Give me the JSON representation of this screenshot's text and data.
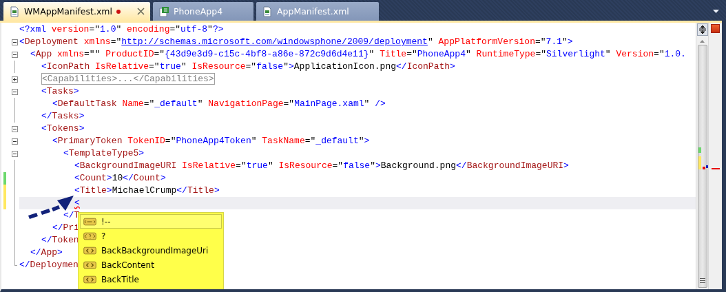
{
  "tabs": [
    {
      "label": "WMAppManifest.xml",
      "kind": "xml",
      "selected": true,
      "modified": true
    },
    {
      "label": "PhoneApp4",
      "kind": "project",
      "selected": false,
      "modified": false
    },
    {
      "label": "AppManifest.xml",
      "kind": "xml",
      "selected": false,
      "modified": false
    }
  ],
  "editor": {
    "lines": [
      {
        "tokens": [
          {
            "kind": "punct",
            "text": "<?xml"
          },
          {
            "kind": "attr",
            "text": " version"
          },
          {
            "kind": "quote",
            "text": "=\""
          },
          {
            "kind": "value",
            "text": "1.0"
          },
          {
            "kind": "quote",
            "text": "\""
          },
          {
            "kind": "attr",
            "text": " encoding"
          },
          {
            "kind": "quote",
            "text": "=\""
          },
          {
            "kind": "value",
            "text": "utf-8"
          },
          {
            "kind": "quote",
            "text": "\""
          },
          {
            "kind": "punct",
            "text": "?>"
          }
        ]
      },
      {
        "expanded": true,
        "tokens": [
          {
            "kind": "punct",
            "text": "<"
          },
          {
            "kind": "tag",
            "text": "Deployment"
          },
          {
            "kind": "attr",
            "text": " xmlns"
          },
          {
            "kind": "quote",
            "text": "=\""
          },
          {
            "kind": "link",
            "text": "http://schemas.microsoft.com/windowsphone/2009/deployment"
          },
          {
            "kind": "quote",
            "text": "\""
          },
          {
            "kind": "attr",
            "text": " AppPlatformVersion"
          },
          {
            "kind": "quote",
            "text": "=\""
          },
          {
            "kind": "value",
            "text": "7.1"
          },
          {
            "kind": "quote",
            "text": "\""
          },
          {
            "kind": "punct",
            "text": ">"
          }
        ],
        "children": [
          {
            "expanded": true,
            "tokens": [
              {
                "kind": "punct",
                "text": "<"
              },
              {
                "kind": "tag",
                "text": "App"
              },
              {
                "kind": "attr",
                "text": " xmlns"
              },
              {
                "kind": "quote",
                "text": "=\"\""
              },
              {
                "kind": "attr",
                "text": " ProductID"
              },
              {
                "kind": "quote",
                "text": "=\""
              },
              {
                "kind": "value",
                "text": "{43d9e3d9-c15c-4bf8-a86e-872c9d6d4e11}"
              },
              {
                "kind": "quote",
                "text": "\""
              },
              {
                "kind": "attr",
                "text": " Title"
              },
              {
                "kind": "quote",
                "text": "=\""
              },
              {
                "kind": "value",
                "text": "PhoneApp4"
              },
              {
                "kind": "quote",
                "text": "\""
              },
              {
                "kind": "attr",
                "text": " RuntimeType"
              },
              {
                "kind": "quote",
                "text": "=\""
              },
              {
                "kind": "value",
                "text": "Silverlight"
              },
              {
                "kind": "quote",
                "text": "\""
              },
              {
                "kind": "attr",
                "text": " Version"
              },
              {
                "kind": "quote",
                "text": "=\""
              },
              {
                "kind": "value",
                "text": "1.0."
              }
            ],
            "children": [
              {
                "tokens": [
                  {
                    "kind": "punct",
                    "text": "<"
                  },
                  {
                    "kind": "tag",
                    "text": "IconPath"
                  },
                  {
                    "kind": "attr",
                    "text": " IsRelative"
                  },
                  {
                    "kind": "quote",
                    "text": "=\""
                  },
                  {
                    "kind": "value",
                    "text": "true"
                  },
                  {
                    "kind": "quote",
                    "text": "\""
                  },
                  {
                    "kind": "attr",
                    "text": " IsResource"
                  },
                  {
                    "kind": "quote",
                    "text": "=\""
                  },
                  {
                    "kind": "value",
                    "text": "false"
                  },
                  {
                    "kind": "quote",
                    "text": "\""
                  },
                  {
                    "kind": "punct",
                    "text": ">"
                  },
                  {
                    "kind": "text",
                    "text": "ApplicationIcon.png"
                  },
                  {
                    "kind": "punct",
                    "text": "</"
                  },
                  {
                    "kind": "tag",
                    "text": "IconPath"
                  },
                  {
                    "kind": "punct",
                    "text": ">"
                  }
                ]
              },
              {
                "expanded": false,
                "tokens": [
                  {
                    "kind": "collapsed",
                    "text": "<Capabilities>...</Capabilities>"
                  }
                ]
              },
              {
                "expanded": true,
                "tokens": [
                  {
                    "kind": "punct",
                    "text": "<"
                  },
                  {
                    "kind": "tag",
                    "text": "Tasks"
                  },
                  {
                    "kind": "punct",
                    "text": ">"
                  }
                ],
                "children": [
                  {
                    "tokens": [
                      {
                        "kind": "punct",
                        "text": "<"
                      },
                      {
                        "kind": "tag",
                        "text": "DefaultTask"
                      },
                      {
                        "kind": "attr",
                        "text": " Name"
                      },
                      {
                        "kind": "quote",
                        "text": "=\""
                      },
                      {
                        "kind": "value",
                        "text": "_default"
                      },
                      {
                        "kind": "quote",
                        "text": "\""
                      },
                      {
                        "kind": "attr",
                        "text": " NavigationPage"
                      },
                      {
                        "kind": "quote",
                        "text": "=\""
                      },
                      {
                        "kind": "value",
                        "text": "MainPage.xaml"
                      },
                      {
                        "kind": "quote",
                        "text": "\""
                      },
                      {
                        "kind": "punct",
                        "text": " />"
                      }
                    ]
                  }
                ]
              },
              {
                "tokens": [
                  {
                    "kind": "punct",
                    "text": "</"
                  },
                  {
                    "kind": "tag",
                    "text": "Tasks"
                  },
                  {
                    "kind": "punct",
                    "text": ">"
                  }
                ]
              },
              {
                "expanded": true,
                "tokens": [
                  {
                    "kind": "punct",
                    "text": "<"
                  },
                  {
                    "kind": "tag",
                    "text": "Tokens"
                  },
                  {
                    "kind": "punct",
                    "text": ">"
                  }
                ],
                "children": [
                  {
                    "expanded": true,
                    "tokens": [
                      {
                        "kind": "punct",
                        "text": "<"
                      },
                      {
                        "kind": "tag",
                        "text": "PrimaryToken"
                      },
                      {
                        "kind": "attr",
                        "text": " TokenID"
                      },
                      {
                        "kind": "quote",
                        "text": "=\""
                      },
                      {
                        "kind": "value",
                        "text": "PhoneApp4Token"
                      },
                      {
                        "kind": "quote",
                        "text": "\""
                      },
                      {
                        "kind": "attr",
                        "text": " TaskName"
                      },
                      {
                        "kind": "quote",
                        "text": "=\""
                      },
                      {
                        "kind": "value",
                        "text": "_default"
                      },
                      {
                        "kind": "quote",
                        "text": "\""
                      },
                      {
                        "kind": "punct",
                        "text": ">"
                      }
                    ],
                    "children": [
                      {
                        "expanded": true,
                        "tokens": [
                          {
                            "kind": "punct",
                            "text": "<"
                          },
                          {
                            "kind": "tag",
                            "text": "TemplateType5"
                          },
                          {
                            "kind": "punct",
                            "text": ">"
                          }
                        ],
                        "children": [
                          {
                            "tokens": [
                              {
                                "kind": "punct",
                                "text": "<"
                              },
                              {
                                "kind": "tag",
                                "text": "BackgroundImageURI"
                              },
                              {
                                "kind": "attr",
                                "text": " IsRelative"
                              },
                              {
                                "kind": "quote",
                                "text": "=\""
                              },
                              {
                                "kind": "value",
                                "text": "true"
                              },
                              {
                                "kind": "quote",
                                "text": "\""
                              },
                              {
                                "kind": "attr",
                                "text": " IsResource"
                              },
                              {
                                "kind": "quote",
                                "text": "=\""
                              },
                              {
                                "kind": "value",
                                "text": "false"
                              },
                              {
                                "kind": "quote",
                                "text": "\""
                              },
                              {
                                "kind": "punct",
                                "text": ">"
                              },
                              {
                                "kind": "text",
                                "text": "Background.png"
                              },
                              {
                                "kind": "punct",
                                "text": "</"
                              },
                              {
                                "kind": "tag",
                                "text": "BackgroundImageURI"
                              },
                              {
                                "kind": "punct",
                                "text": ">"
                              }
                            ]
                          },
                          {
                            "changed": true,
                            "saved": true,
                            "tokens": [
                              {
                                "kind": "punct",
                                "text": "<"
                              },
                              {
                                "kind": "tag",
                                "text": "Count"
                              },
                              {
                                "kind": "punct",
                                "text": ">"
                              },
                              {
                                "kind": "text",
                                "text": "10"
                              },
                              {
                                "kind": "punct",
                                "text": "</"
                              },
                              {
                                "kind": "tag",
                                "text": "Count"
                              },
                              {
                                "kind": "punct",
                                "text": ">"
                              }
                            ]
                          },
                          {
                            "changed": true,
                            "saved": false,
                            "tokens": [
                              {
                                "kind": "punct",
                                "text": "<"
                              },
                              {
                                "kind": "tag",
                                "text": "Title"
                              },
                              {
                                "kind": "punct",
                                "text": ">"
                              },
                              {
                                "kind": "text",
                                "text": "MichaelCrump"
                              },
                              {
                                "kind": "punct",
                                "text": "</"
                              },
                              {
                                "kind": "tag",
                                "text": "Title"
                              },
                              {
                                "kind": "punct",
                                "text": ">"
                              }
                            ]
                          },
                          {
                            "changed": true,
                            "saved": false,
                            "current": true,
                            "tokens": [
                              {
                                "kind": "punct",
                                "text": "<",
                                "error": true
                              }
                            ]
                          }
                        ]
                      },
                      {
                        "tokens": [
                          {
                            "kind": "punct",
                            "text": "</"
                          },
                          {
                            "kind": "tag",
                            "text": "T"
                          }
                        ]
                      }
                    ]
                  },
                  {
                    "tokens": [
                      {
                        "kind": "punct",
                        "text": "</"
                      },
                      {
                        "kind": "tag",
                        "text": "Pri"
                      }
                    ]
                  }
                ]
              },
              {
                "tokens": [
                  {
                    "kind": "punct",
                    "text": "</"
                  },
                  {
                    "kind": "tag",
                    "text": "Token"
                  }
                ]
              }
            ]
          },
          {
            "tokens": [
              {
                "kind": "punct",
                "text": "</"
              },
              {
                "kind": "tag",
                "text": "App"
              },
              {
                "kind": "punct",
                "text": ">"
              }
            ]
          }
        ]
      },
      {
        "tokens": [
          {
            "kind": "punct",
            "text": "</"
          },
          {
            "kind": "tag",
            "text": "Deploymen"
          }
        ]
      }
    ]
  },
  "completion": {
    "items": [
      {
        "kind": "comment",
        "label": "!--",
        "selected": true
      },
      {
        "kind": "instruction",
        "label": "?",
        "selected": false
      },
      {
        "kind": "element",
        "label": "BackBackgroundImageUri",
        "selected": false
      },
      {
        "kind": "element",
        "label": "BackContent",
        "selected": false
      },
      {
        "kind": "element",
        "label": "BackTitle",
        "selected": false
      }
    ]
  }
}
